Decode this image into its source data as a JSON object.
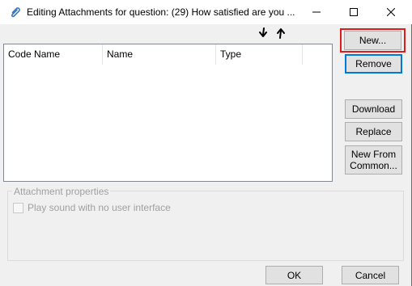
{
  "window": {
    "title": "Editing Attachments for question: (29) How satisfied are you ...",
    "title_icon": "paperclip-icon"
  },
  "toolbar": {
    "move_down_icon": "arrow-down-icon",
    "move_up_icon": "arrow-up-icon"
  },
  "list": {
    "columns": [
      "Code Name",
      "Name",
      "Type"
    ],
    "rows": []
  },
  "buttons": {
    "new": "New...",
    "remove": "Remove",
    "download": "Download",
    "replace": "Replace",
    "new_from_common": "New From Common...",
    "ok": "OK",
    "cancel": "Cancel"
  },
  "attachment_properties": {
    "group_label": "Attachment properties",
    "checkbox_label": "Play sound with no user interface",
    "checkbox_checked": false,
    "enabled": false
  },
  "colors": {
    "highlight": "#e01b1b",
    "focus": "#0078d7"
  }
}
